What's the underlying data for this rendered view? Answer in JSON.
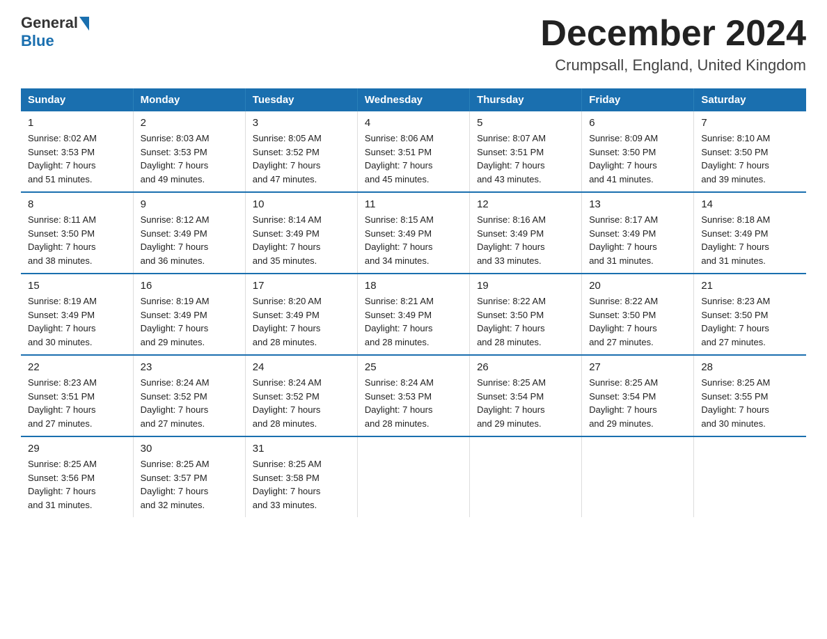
{
  "logo": {
    "text1": "General",
    "text2": "Blue"
  },
  "title": "December 2024",
  "subtitle": "Crumpsall, England, United Kingdom",
  "days_header": [
    "Sunday",
    "Monday",
    "Tuesday",
    "Wednesday",
    "Thursday",
    "Friday",
    "Saturday"
  ],
  "weeks": [
    [
      {
        "num": "1",
        "sunrise": "8:02 AM",
        "sunset": "3:53 PM",
        "daylight": "7 hours and 51 minutes."
      },
      {
        "num": "2",
        "sunrise": "8:03 AM",
        "sunset": "3:53 PM",
        "daylight": "7 hours and 49 minutes."
      },
      {
        "num": "3",
        "sunrise": "8:05 AM",
        "sunset": "3:52 PM",
        "daylight": "7 hours and 47 minutes."
      },
      {
        "num": "4",
        "sunrise": "8:06 AM",
        "sunset": "3:51 PM",
        "daylight": "7 hours and 45 minutes."
      },
      {
        "num": "5",
        "sunrise": "8:07 AM",
        "sunset": "3:51 PM",
        "daylight": "7 hours and 43 minutes."
      },
      {
        "num": "6",
        "sunrise": "8:09 AM",
        "sunset": "3:50 PM",
        "daylight": "7 hours and 41 minutes."
      },
      {
        "num": "7",
        "sunrise": "8:10 AM",
        "sunset": "3:50 PM",
        "daylight": "7 hours and 39 minutes."
      }
    ],
    [
      {
        "num": "8",
        "sunrise": "8:11 AM",
        "sunset": "3:50 PM",
        "daylight": "7 hours and 38 minutes."
      },
      {
        "num": "9",
        "sunrise": "8:12 AM",
        "sunset": "3:49 PM",
        "daylight": "7 hours and 36 minutes."
      },
      {
        "num": "10",
        "sunrise": "8:14 AM",
        "sunset": "3:49 PM",
        "daylight": "7 hours and 35 minutes."
      },
      {
        "num": "11",
        "sunrise": "8:15 AM",
        "sunset": "3:49 PM",
        "daylight": "7 hours and 34 minutes."
      },
      {
        "num": "12",
        "sunrise": "8:16 AM",
        "sunset": "3:49 PM",
        "daylight": "7 hours and 33 minutes."
      },
      {
        "num": "13",
        "sunrise": "8:17 AM",
        "sunset": "3:49 PM",
        "daylight": "7 hours and 31 minutes."
      },
      {
        "num": "14",
        "sunrise": "8:18 AM",
        "sunset": "3:49 PM",
        "daylight": "7 hours and 31 minutes."
      }
    ],
    [
      {
        "num": "15",
        "sunrise": "8:19 AM",
        "sunset": "3:49 PM",
        "daylight": "7 hours and 30 minutes."
      },
      {
        "num": "16",
        "sunrise": "8:19 AM",
        "sunset": "3:49 PM",
        "daylight": "7 hours and 29 minutes."
      },
      {
        "num": "17",
        "sunrise": "8:20 AM",
        "sunset": "3:49 PM",
        "daylight": "7 hours and 28 minutes."
      },
      {
        "num": "18",
        "sunrise": "8:21 AM",
        "sunset": "3:49 PM",
        "daylight": "7 hours and 28 minutes."
      },
      {
        "num": "19",
        "sunrise": "8:22 AM",
        "sunset": "3:50 PM",
        "daylight": "7 hours and 28 minutes."
      },
      {
        "num": "20",
        "sunrise": "8:22 AM",
        "sunset": "3:50 PM",
        "daylight": "7 hours and 27 minutes."
      },
      {
        "num": "21",
        "sunrise": "8:23 AM",
        "sunset": "3:50 PM",
        "daylight": "7 hours and 27 minutes."
      }
    ],
    [
      {
        "num": "22",
        "sunrise": "8:23 AM",
        "sunset": "3:51 PM",
        "daylight": "7 hours and 27 minutes."
      },
      {
        "num": "23",
        "sunrise": "8:24 AM",
        "sunset": "3:52 PM",
        "daylight": "7 hours and 27 minutes."
      },
      {
        "num": "24",
        "sunrise": "8:24 AM",
        "sunset": "3:52 PM",
        "daylight": "7 hours and 28 minutes."
      },
      {
        "num": "25",
        "sunrise": "8:24 AM",
        "sunset": "3:53 PM",
        "daylight": "7 hours and 28 minutes."
      },
      {
        "num": "26",
        "sunrise": "8:25 AM",
        "sunset": "3:54 PM",
        "daylight": "7 hours and 29 minutes."
      },
      {
        "num": "27",
        "sunrise": "8:25 AM",
        "sunset": "3:54 PM",
        "daylight": "7 hours and 29 minutes."
      },
      {
        "num": "28",
        "sunrise": "8:25 AM",
        "sunset": "3:55 PM",
        "daylight": "7 hours and 30 minutes."
      }
    ],
    [
      {
        "num": "29",
        "sunrise": "8:25 AM",
        "sunset": "3:56 PM",
        "daylight": "7 hours and 31 minutes."
      },
      {
        "num": "30",
        "sunrise": "8:25 AM",
        "sunset": "3:57 PM",
        "daylight": "7 hours and 32 minutes."
      },
      {
        "num": "31",
        "sunrise": "8:25 AM",
        "sunset": "3:58 PM",
        "daylight": "7 hours and 33 minutes."
      },
      null,
      null,
      null,
      null
    ]
  ]
}
